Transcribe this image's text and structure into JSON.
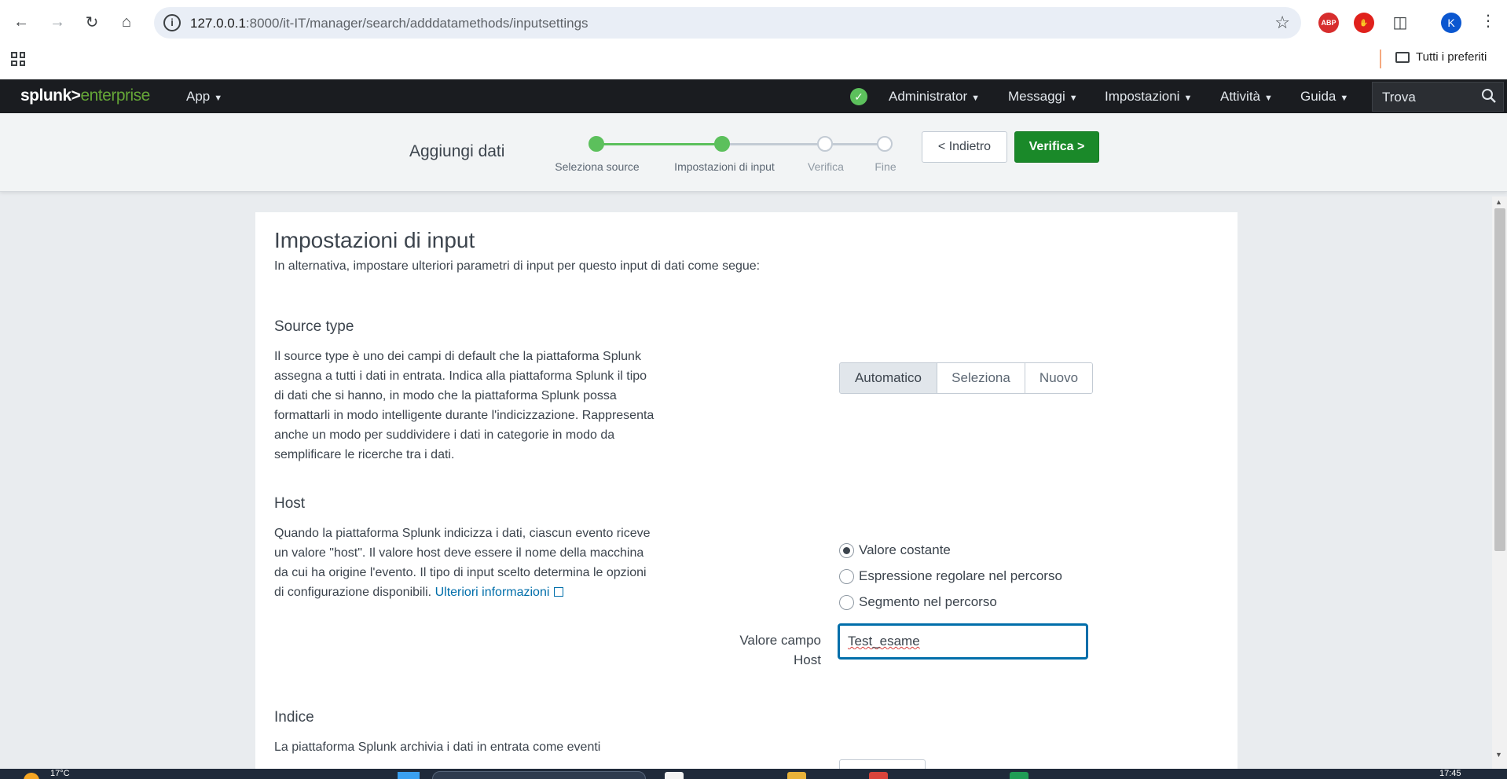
{
  "browser": {
    "url_host": "127.0.0.1",
    "url_path": ":8000/it-IT/manager/search/adddatamethods/inputsettings",
    "bookmarks_label": "Tutti i preferiti",
    "profile_initial": "K",
    "extensions": [
      {
        "name": "adblock-plus",
        "label": "ABP",
        "color": "#d72d2d"
      },
      {
        "name": "adblock",
        "label": "",
        "color": "#e0211c"
      }
    ]
  },
  "splunk": {
    "logo_main": "splunk>",
    "logo_product": "enterprise",
    "app_menu": "App",
    "menu": [
      "Administrator",
      "Messaggi",
      "Impostazioni",
      "Attività",
      "Guida"
    ],
    "search_label": "Trova",
    "status_color": "#5cc05c"
  },
  "wizard": {
    "title": "Aggiungi dati",
    "steps": [
      {
        "label": "Seleziona source",
        "state": "done"
      },
      {
        "label": "Impostazioni di input",
        "state": "current"
      },
      {
        "label": "Verifica",
        "state": "todo"
      },
      {
        "label": "Fine",
        "state": "todo"
      }
    ],
    "back_label": "< Indietro",
    "next_label": "Verifica >",
    "accent_color": "#1a8929"
  },
  "page": {
    "title": "Impostazioni di input",
    "intro": "In alternativa, impostare ulteriori parametri di input per questo input di dati come segue:",
    "source_type": {
      "heading": "Source type",
      "description": "Il source type è uno dei campi di default che la piattaforma Splunk assegna a tutti i dati in entrata. Indica alla piattaforma Splunk il tipo di dati che si hanno, in modo che la piattaforma Splunk possa formattarli in modo intelligente durante l'indicizzazione. Rappresenta anche un modo per suddividere i dati in categorie in modo da semplificare le ricerche tra i dati.",
      "options": [
        "Automatico",
        "Seleziona",
        "Nuovo"
      ],
      "selected": "Automatico"
    },
    "host": {
      "heading": "Host",
      "description": "Quando la piattaforma Splunk indicizza i dati, ciascun evento riceve un valore \"host\". Il valore host deve essere il nome della macchina da cui ha origine l'evento. Il tipo di input scelto determina le opzioni di configurazione disponibili.",
      "link_text": "Ulteriori informazioni",
      "radio_options": [
        "Valore costante",
        "Espressione regolare nel percorso",
        "Segmento nel percorso"
      ],
      "selected": "Valore costante",
      "field_label": "Valore campo Host",
      "field_value": "Test_esame"
    },
    "index": {
      "heading": "Indice",
      "description": "La piattaforma Splunk archivia i dati in entrata come eventi"
    }
  },
  "taskbar": {
    "temperature": "17°C",
    "time": "17:45"
  }
}
